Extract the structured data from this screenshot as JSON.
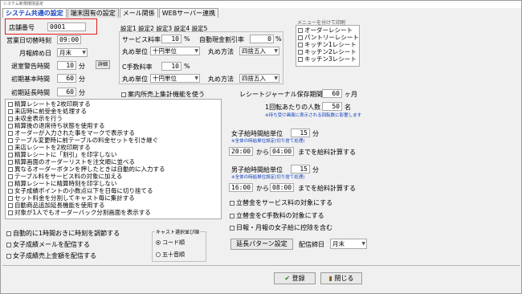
{
  "window": {
    "title": "システム新規環境設定"
  },
  "tabs": [
    "システム共通の設定",
    "端末固有の設定",
    "メール関係",
    "WEBサーバー連携"
  ],
  "left": {
    "store_no_label": "店舗番号",
    "store_no_value": "0001",
    "cutoff_label": "営業日切替時刻",
    "cutoff_value": "09:00",
    "monthly_label": "月報締め日",
    "monthly_value": "月末",
    "leave_warn_label": "退室警告時間",
    "leave_warn_value": "10",
    "leave_warn_unit": "分",
    "detail_button": "詳細",
    "base_time_label": "初期基本時間",
    "base_time_value": "60",
    "base_time_unit": "分",
    "ext_time_label": "初期延長時間",
    "ext_time_value": "60",
    "ext_time_unit": "分"
  },
  "settings": {
    "tabs": [
      "設定1",
      "設定2",
      "設定3",
      "設定4",
      "設定5"
    ],
    "service_label": "サービス料率",
    "service_value": "10",
    "service_unit": "%",
    "auto_discount_label": "自動現金割引率",
    "auto_discount_value": "0",
    "auto_discount_unit": "%",
    "round_unit_label": "丸め単位",
    "round_unit_value": "十円単位",
    "round_method_label": "丸め方法",
    "round_method_value": "四捨五入",
    "c_fee_label": "C手数料率",
    "c_fee_value": "10",
    "c_fee_unit": "%",
    "round_unit2_label": "丸め単位",
    "round_unit2_value": "十円単位",
    "round_method2_label": "丸め方法",
    "round_method2_value": "四捨五入"
  },
  "print_menu": {
    "title": "メニューを分けて印刷",
    "items": [
      "オーダーレシート",
      "パントリーレシート",
      "キッチン1レシート",
      "キッチン2レシート",
      "キッチン3レシート"
    ]
  },
  "in_store_label": "案内所売上集計機能を使う",
  "journal": {
    "label": "レシートジャーナル保存期間",
    "value": "60",
    "unit": "ヶ月"
  },
  "print_count": {
    "label": "1回転あたりの人数",
    "value": "50",
    "unit": "名",
    "note": "※待ち受け画面に表示される回転数に影響します"
  },
  "female": {
    "label": "女子給時間給単位",
    "value": "15",
    "unit": "分",
    "note": "※全体の時給単位設定(切り捨て処理)",
    "from": "20:00",
    "from_label": "から",
    "to": "04:00",
    "to_label": "までを給料計算する"
  },
  "male": {
    "label": "男子給時間給単位",
    "value": "15",
    "unit": "分",
    "note": "※全体の時給単位設定(切り捨て処理)",
    "from": "16:00",
    "from_label": "から",
    "to": "08:00",
    "to_label": "までを給料計算する"
  },
  "right_checks": [
    "立替金をサービス料の対象にする",
    "立替金をC手数料の対象にする",
    "日報・月報の女子給に控除を含む"
  ],
  "options_list": [
    "精算レシートを2枚印刷する",
    "来店時に前受金を処理する",
    "未収金表示を行う",
    "精算後の退席待ち状態を使用する",
    "オーダーが入力された事をマークで表示する",
    "テーブル変更時に前テーブルの料金セットを引き継ぐ",
    "来店レシートを2枚印刷する",
    "精算レシートに「割引」を印字しない",
    "精算画面のオーダーリストを注文順に並べる",
    "異なるオーダーボタンを押したときは自動的に入力する",
    "テーブル料をサービス料の対象に加える",
    "精算レシートに精算時刻を印字しない",
    "女子成績ポイントの小数点以下を日毎に切り捨てる",
    "セット料金を分割してキャスト毎に集計する",
    "自動商品追加延長機能を使用する",
    "対象が1人でもオーダーバック分割画面を表示する"
  ],
  "bottom_checks": [
    "自動的に1時間おきに時刻を調節する",
    "女子成績メールを配信する",
    "女子成績売上金額を配信する"
  ],
  "cast_order": {
    "title": "キャスト選択並び順",
    "options": [
      "コード順",
      "五十音順"
    ]
  },
  "ext_pattern_button": "延長パターン設定",
  "delivery": {
    "label": "配信締日",
    "value": "月末"
  },
  "register_button": "登録",
  "close_button": "閉じる"
}
